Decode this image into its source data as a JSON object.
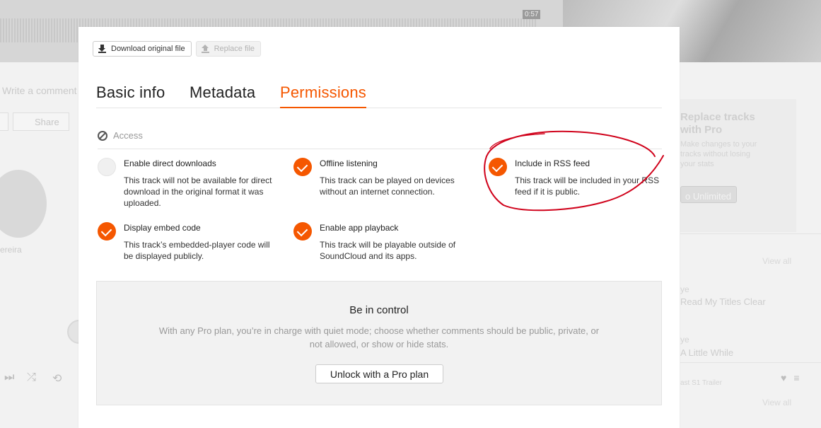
{
  "background": {
    "time": "0:57",
    "comment_placeholder": "Write a comment",
    "share_label": "Share",
    "profile_name": "ereira",
    "right": {
      "promo_title": "Replace tracks with Pro",
      "promo_text": "Make changes to your tracks without losing your stats",
      "promo_button": "o Unlimited",
      "view_all_1": "View all",
      "likes_1": "ye",
      "track_1": "Read My Titles Clear",
      "likes_2": "ye",
      "track_2": "A Little While",
      "small_1": "ast S1 Trailer",
      "view_all_2": "View all"
    }
  },
  "modal": {
    "file_bar": {
      "download_label": "Download original file",
      "replace_label": "Replace file"
    },
    "tabs": [
      {
        "label": "Basic info",
        "active": false
      },
      {
        "label": "Metadata",
        "active": false
      },
      {
        "label": "Permissions",
        "active": true
      }
    ],
    "section_heading": "Access",
    "permissions": [
      {
        "title": "Enable direct downloads",
        "description": "This track will not be available for direct download in the original format it was uploaded.",
        "checked": false
      },
      {
        "title": "Offline listening",
        "description": "This track can be played on devices without an internet connection.",
        "checked": true
      },
      {
        "title": "Include in RSS feed",
        "description": "This track will be included in your RSS feed if it is public.",
        "checked": true
      },
      {
        "title": "Display embed code",
        "description": "This track’s embedded-player code will be displayed publicly.",
        "checked": true
      },
      {
        "title": "Enable app playback",
        "description": "This track will be playable outside of SoundCloud and its apps.",
        "checked": true
      }
    ],
    "promo": {
      "title": "Be in control",
      "text": "With any Pro plan, you’re in charge with quiet mode; choose whether comments should be public, private, or not allowed, or show or hide stats.",
      "button_label": "Unlock with a Pro plan"
    }
  },
  "colors": {
    "accent": "#f55700",
    "annotation": "#d0021b"
  }
}
